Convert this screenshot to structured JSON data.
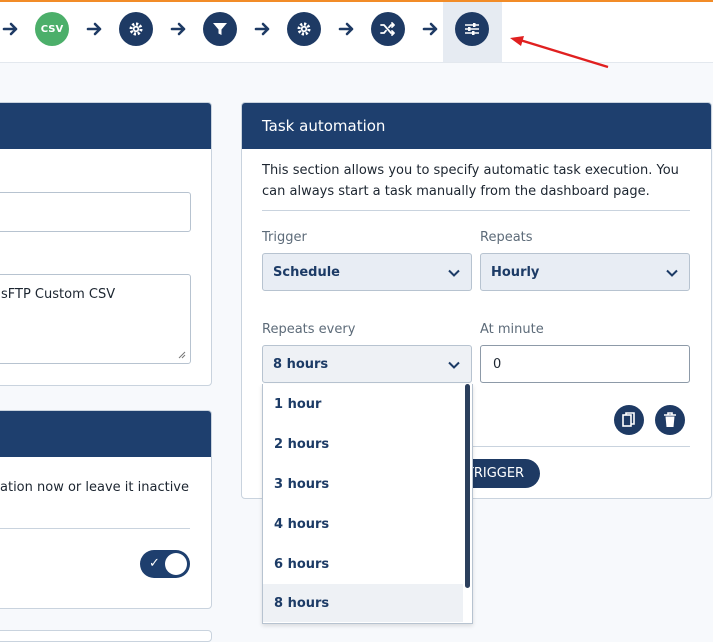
{
  "toolbar": {
    "steps": [
      {
        "icon": "csv-icon",
        "label": "CSV"
      },
      {
        "icon": "gear-icon"
      },
      {
        "icon": "filter-icon"
      },
      {
        "icon": "gear-icon"
      },
      {
        "icon": "shuffle-icon"
      },
      {
        "icon": "sliders-icon",
        "active": true
      }
    ],
    "accent_color": "#f28c28"
  },
  "left_panel": {
    "textarea_value": "sFTP Custom CSV",
    "activation_text": "ation now or leave it inactive",
    "toggle_on": true
  },
  "task_automation": {
    "title": "Task automation",
    "description": "This section allows you to specify automatic task execution. You can always start a task manually from the dashboard page.",
    "trigger_label": "Trigger",
    "trigger_value": "Schedule",
    "repeats_label": "Repeats",
    "repeats_value": "Hourly",
    "repeats_every_label": "Repeats every",
    "repeats_every_value": "8 hours",
    "at_minute_label": "At minute",
    "at_minute_value": "0",
    "add_trigger_label": "TRIGGER",
    "options": [
      "1 hour",
      "2 hours",
      "3 hours",
      "4 hours",
      "6 hours",
      "8 hours"
    ],
    "selected_option": "8 hours"
  },
  "colors": {
    "header": "#1e3f6e",
    "icon_circle": "#1e3a64",
    "csv_badge": "#4caf6a",
    "annotation_arrow": "#e02020"
  }
}
